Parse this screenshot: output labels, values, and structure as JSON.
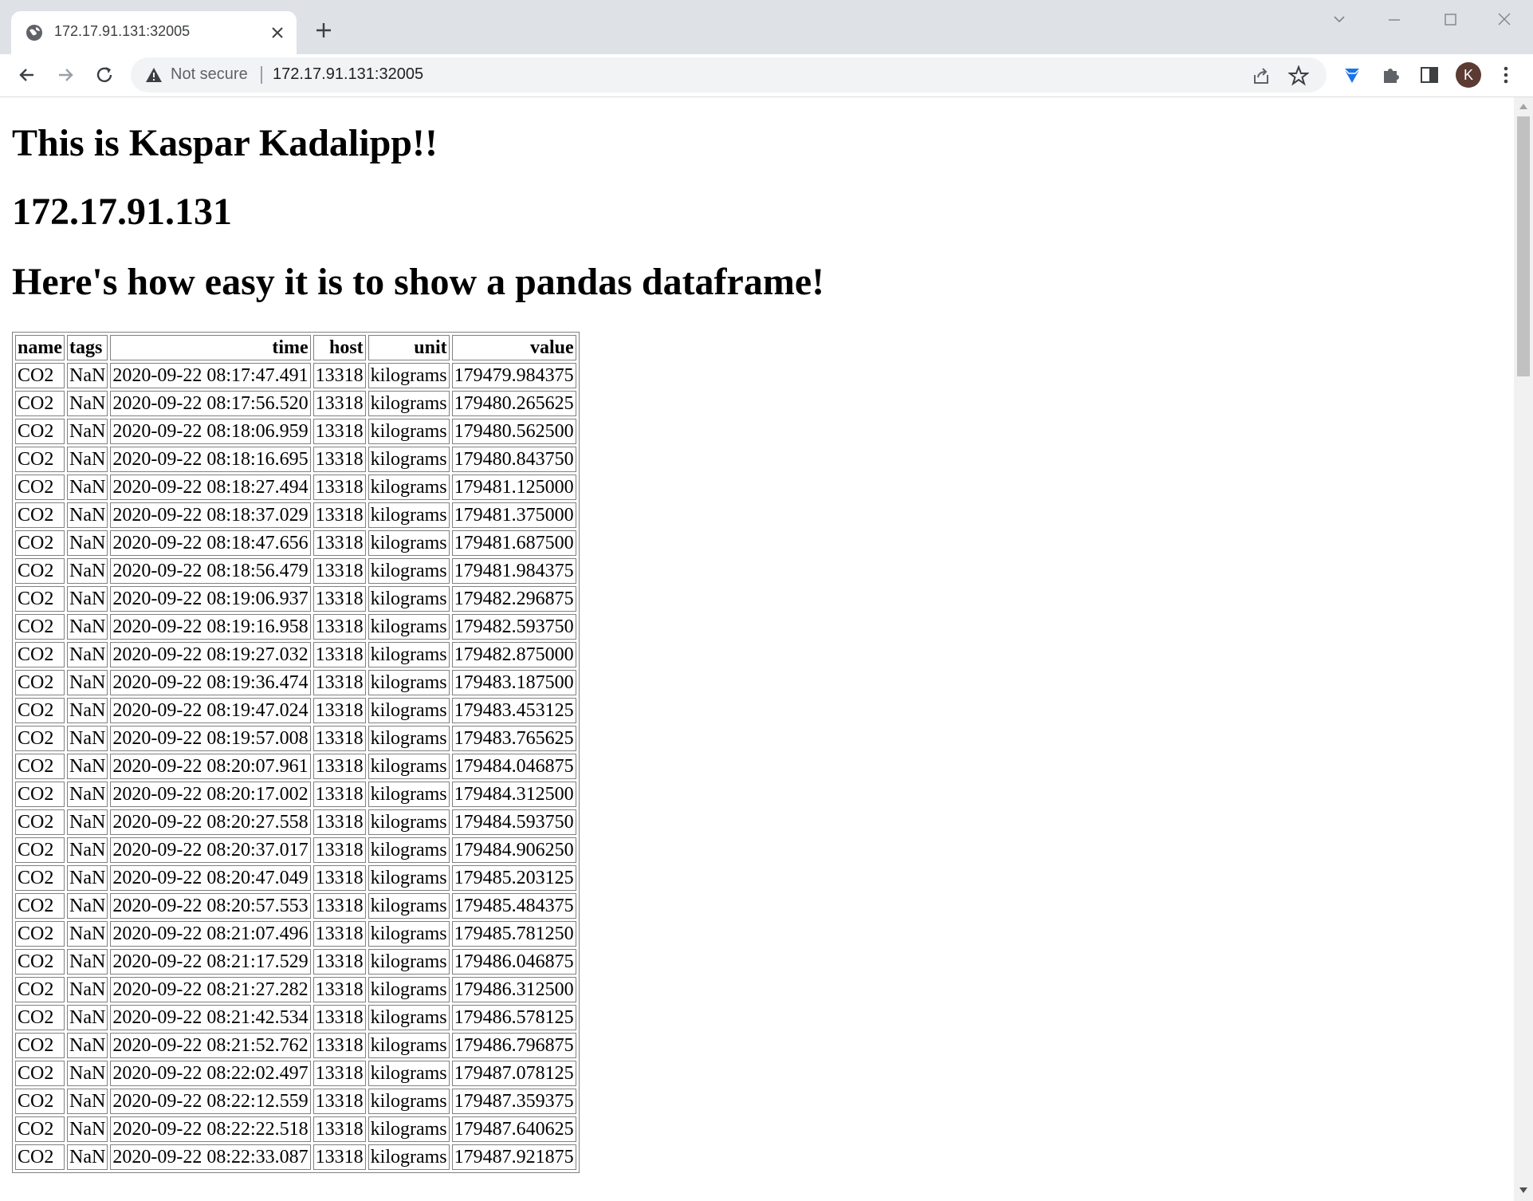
{
  "browser": {
    "tab_title": "172.17.91.131:32005",
    "security_label": "Not secure",
    "url": "172.17.91.131:32005",
    "profile_initial": "K",
    "icons": [
      "globe-icon",
      "close-icon",
      "plus-icon",
      "back-icon",
      "forward-icon",
      "reload-icon",
      "warning-icon",
      "share-icon",
      "star-icon",
      "extension-diamond-icon",
      "puzzle-icon",
      "side-panel-icon",
      "menu-icon"
    ]
  },
  "page": {
    "heading_1": "This is Kaspar Kadalipp!!",
    "heading_2": "172.17.91.131",
    "heading_3": "Here's how easy it is to show a pandas dataframe!"
  },
  "table": {
    "columns": [
      "name",
      "tags",
      "time",
      "host",
      "unit",
      "value"
    ],
    "rows": [
      [
        "CO2",
        "NaN",
        "2020-09-22 08:17:47.491",
        "13318",
        "kilograms",
        "179479.984375"
      ],
      [
        "CO2",
        "NaN",
        "2020-09-22 08:17:56.520",
        "13318",
        "kilograms",
        "179480.265625"
      ],
      [
        "CO2",
        "NaN",
        "2020-09-22 08:18:06.959",
        "13318",
        "kilograms",
        "179480.562500"
      ],
      [
        "CO2",
        "NaN",
        "2020-09-22 08:18:16.695",
        "13318",
        "kilograms",
        "179480.843750"
      ],
      [
        "CO2",
        "NaN",
        "2020-09-22 08:18:27.494",
        "13318",
        "kilograms",
        "179481.125000"
      ],
      [
        "CO2",
        "NaN",
        "2020-09-22 08:18:37.029",
        "13318",
        "kilograms",
        "179481.375000"
      ],
      [
        "CO2",
        "NaN",
        "2020-09-22 08:18:47.656",
        "13318",
        "kilograms",
        "179481.687500"
      ],
      [
        "CO2",
        "NaN",
        "2020-09-22 08:18:56.479",
        "13318",
        "kilograms",
        "179481.984375"
      ],
      [
        "CO2",
        "NaN",
        "2020-09-22 08:19:06.937",
        "13318",
        "kilograms",
        "179482.296875"
      ],
      [
        "CO2",
        "NaN",
        "2020-09-22 08:19:16.958",
        "13318",
        "kilograms",
        "179482.593750"
      ],
      [
        "CO2",
        "NaN",
        "2020-09-22 08:19:27.032",
        "13318",
        "kilograms",
        "179482.875000"
      ],
      [
        "CO2",
        "NaN",
        "2020-09-22 08:19:36.474",
        "13318",
        "kilograms",
        "179483.187500"
      ],
      [
        "CO2",
        "NaN",
        "2020-09-22 08:19:47.024",
        "13318",
        "kilograms",
        "179483.453125"
      ],
      [
        "CO2",
        "NaN",
        "2020-09-22 08:19:57.008",
        "13318",
        "kilograms",
        "179483.765625"
      ],
      [
        "CO2",
        "NaN",
        "2020-09-22 08:20:07.961",
        "13318",
        "kilograms",
        "179484.046875"
      ],
      [
        "CO2",
        "NaN",
        "2020-09-22 08:20:17.002",
        "13318",
        "kilograms",
        "179484.312500"
      ],
      [
        "CO2",
        "NaN",
        "2020-09-22 08:20:27.558",
        "13318",
        "kilograms",
        "179484.593750"
      ],
      [
        "CO2",
        "NaN",
        "2020-09-22 08:20:37.017",
        "13318",
        "kilograms",
        "179484.906250"
      ],
      [
        "CO2",
        "NaN",
        "2020-09-22 08:20:47.049",
        "13318",
        "kilograms",
        "179485.203125"
      ],
      [
        "CO2",
        "NaN",
        "2020-09-22 08:20:57.553",
        "13318",
        "kilograms",
        "179485.484375"
      ],
      [
        "CO2",
        "NaN",
        "2020-09-22 08:21:07.496",
        "13318",
        "kilograms",
        "179485.781250"
      ],
      [
        "CO2",
        "NaN",
        "2020-09-22 08:21:17.529",
        "13318",
        "kilograms",
        "179486.046875"
      ],
      [
        "CO2",
        "NaN",
        "2020-09-22 08:21:27.282",
        "13318",
        "kilograms",
        "179486.312500"
      ],
      [
        "CO2",
        "NaN",
        "2020-09-22 08:21:42.534",
        "13318",
        "kilograms",
        "179486.578125"
      ],
      [
        "CO2",
        "NaN",
        "2020-09-22 08:21:52.762",
        "13318",
        "kilograms",
        "179486.796875"
      ],
      [
        "CO2",
        "NaN",
        "2020-09-22 08:22:02.497",
        "13318",
        "kilograms",
        "179487.078125"
      ],
      [
        "CO2",
        "NaN",
        "2020-09-22 08:22:12.559",
        "13318",
        "kilograms",
        "179487.359375"
      ],
      [
        "CO2",
        "NaN",
        "2020-09-22 08:22:22.518",
        "13318",
        "kilograms",
        "179487.640625"
      ],
      [
        "CO2",
        "NaN",
        "2020-09-22 08:22:33.087",
        "13318",
        "kilograms",
        "179487.921875"
      ]
    ]
  }
}
